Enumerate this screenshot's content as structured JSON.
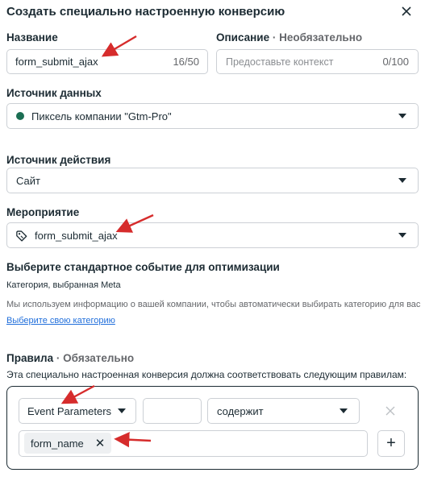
{
  "dialog": {
    "title": "Создать специально настроенную конверсию",
    "close_icon": "close-icon"
  },
  "name_field": {
    "label": "Название",
    "value": "form_submit_ajax",
    "counter": "16/50"
  },
  "description_field": {
    "label": "Описание",
    "optional": "· Необязательно",
    "placeholder": "Предоставьте контекст",
    "counter": "0/100"
  },
  "data_source": {
    "label": "Источник данных",
    "value": "Пиксель компании \"Gtm-Pro\"",
    "status_color": "#1b6e53"
  },
  "action_source": {
    "label": "Источник действия",
    "value": "Сайт"
  },
  "event": {
    "label": "Мероприятие",
    "value": "form_submit_ajax",
    "icon": "tag-icon"
  },
  "optimization": {
    "heading": "Выберите стандартное событие для оптимизации",
    "category_text": "Категория, выбранная Meta",
    "info_text": "Мы используем информацию о вашей компании, чтобы автоматически выбирать категорию для вас",
    "link_text": "Выберите свою категорию"
  },
  "rules": {
    "label": "Правила",
    "required": "· Обязательно",
    "description": "Эта специально настроенная конверсия должна соответствовать следующим правилам:",
    "param_select": "Event Parameters",
    "param_key": "",
    "operator": "содержит",
    "remove_icon": "close-icon",
    "chip": "form_name",
    "add_label": "+"
  },
  "annotations": {
    "arrow_color": "#d62c2c"
  }
}
